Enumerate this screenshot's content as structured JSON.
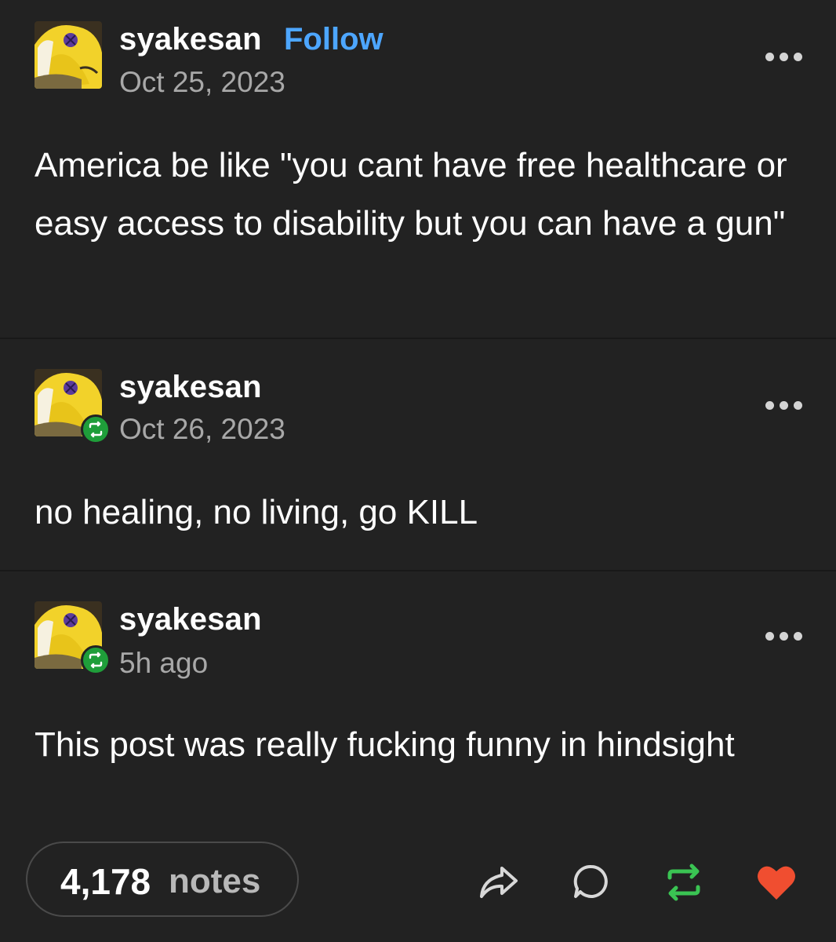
{
  "posts": [
    {
      "username": "syakesan",
      "follow_label": "Follow",
      "date": "Oct 25, 2023",
      "body": "America be like \"you cant have free healthcare or easy access to disability but you can have a gun\""
    },
    {
      "username": "syakesan",
      "date": "Oct 26, 2023",
      "body": "no healing, no living, go KILL"
    },
    {
      "username": "syakesan",
      "date": "5h ago",
      "body": "This post was really fucking funny in hindsight"
    }
  ],
  "footer": {
    "notes_count": "4,178",
    "notes_label": "notes",
    "actions": [
      "share-icon",
      "reply-icon",
      "reblog-icon",
      "like-icon"
    ]
  },
  "colors": {
    "background": "#222222",
    "follow": "#4da6ff",
    "reblog_green": "#1f9e3a",
    "like_red": "#f04e30"
  }
}
